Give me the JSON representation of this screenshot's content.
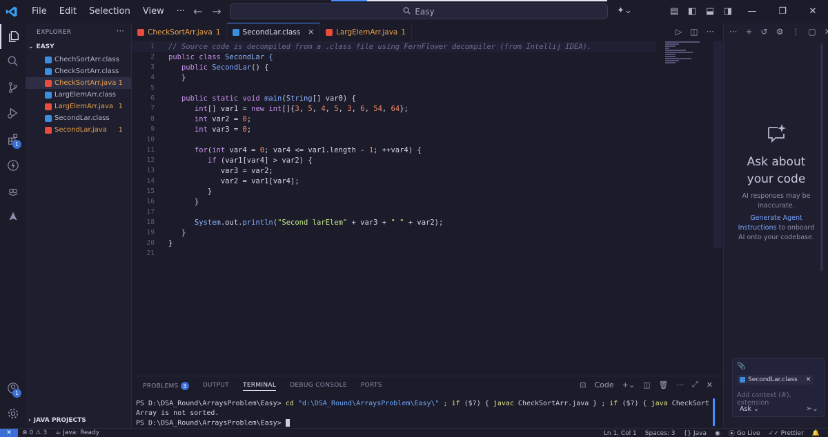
{
  "menu": {
    "file": "File",
    "edit": "Edit",
    "selection": "Selection",
    "view": "View",
    "more": "···"
  },
  "search": {
    "text": "Easy"
  },
  "sidebar": {
    "title": "EXPLORER",
    "more": "···",
    "folder": "EASY",
    "files": [
      {
        "name": "ChechSortArr.class",
        "color": "#3b8ede",
        "text_color": "#b5b5cc",
        "count": ""
      },
      {
        "name": "CheckSortArr.class",
        "color": "#3b8ede",
        "text_color": "#b5b5cc",
        "count": ""
      },
      {
        "name": "CheckSortArr.java",
        "color": "#e74c3c",
        "text_color": "#e9a34a",
        "count": "1"
      },
      {
        "name": "LargElemArr.class",
        "color": "#3b8ede",
        "text_color": "#b5b5cc",
        "count": ""
      },
      {
        "name": "LargElemArr.java",
        "color": "#e74c3c",
        "text_color": "#e9a34a",
        "count": "1"
      },
      {
        "name": "SecondLar.class",
        "color": "#3b8ede",
        "text_color": "#b5b5cc",
        "count": ""
      },
      {
        "name": "SecondLar.java",
        "color": "#e74c3c",
        "text_color": "#e9a34a",
        "count": "1"
      }
    ],
    "java_projects": "JAVA PROJECTS"
  },
  "activity": {
    "ext_badge": "1",
    "account_badge": "1"
  },
  "tabs": [
    {
      "name": "CheckSortArr.java",
      "count": "1",
      "color": "#e74c3c",
      "text_color": "#e9a34a"
    },
    {
      "name": "SecondLar.class",
      "count": "",
      "color": "#3b8ede",
      "text_color": "#e0e0f0",
      "close": "✕"
    },
    {
      "name": "LargElemArr.java",
      "count": "1",
      "color": "#e74c3c",
      "text_color": "#e9a34a"
    }
  ],
  "code": {
    "line_numbers": [
      "1",
      "2",
      "3",
      "4",
      "5",
      "6",
      "7",
      "8",
      "9",
      "10",
      "11",
      "12",
      "13",
      "14",
      "15",
      "16",
      "17",
      "18",
      "19",
      "20",
      "21"
    ],
    "l1": "// Source code is decompiled from a .class file using FernFlower decompiler (from Intellij IDEA).",
    "l2a": "public class",
    "l2b": " SecondLar {",
    "l3a": "   public",
    "l3b": " SecondLar",
    "l3c": "() {",
    "l4": "   }",
    "l6a": "   public static void",
    "l6b": " main",
    "l6c": "(",
    "l6d": "String",
    "l6e": "[] var0) {",
    "l7a": "      int",
    "l7b": "[] var1 = ",
    "l7c": "new int",
    "l7d": "[]{",
    "l7n1": "3",
    "l7n2": "5",
    "l7n3": "4",
    "l7n4": "5",
    "l7n5": "3",
    "l7n6": "6",
    "l7n7": "54",
    "l7n8": "64",
    "l7e": "};",
    "l8a": "      int",
    "l8b": " var2 = ",
    "l8c": "0",
    "l8d": ";",
    "l9a": "      int",
    "l9b": " var3 = ",
    "l9c": "0",
    "l9d": ";",
    "l11a": "      for",
    "l11b": "(",
    "l11c": "int",
    "l11d": " var4 = ",
    "l11e": "0",
    "l11f": "; var4 <= var1.length - ",
    "l11g": "1",
    "l11h": "; ++var4) {",
    "l12a": "         if",
    "l12b": " (var1[var4] > var2) {",
    "l13": "            var3 = var2;",
    "l14": "            var2 = var1[var4];",
    "l15": "         }",
    "l16": "      }",
    "l18a": "      System",
    "l18b": ".out.",
    "l18c": "println",
    "l18d": "(",
    "l18e": "\"Second larElem\"",
    "l18f": " + var3 + ",
    "l18g": "\" \"",
    "l18h": " + var2);",
    "l19": "   }",
    "l20": "}"
  },
  "panel": {
    "tabs": {
      "problems": "PROBLEMS",
      "problems_count": "3",
      "output": "OUTPUT",
      "terminal": "TERMINAL",
      "debug": "DEBUG CONSOLE",
      "ports": "PORTS"
    },
    "code_label": "Code",
    "terminal": {
      "line1_prompt": "PS D:\\DSA_Round\\ArraysProblem\\Easy> ",
      "line1_cd": "cd ",
      "line1_path": "\"d:\\DSA_Round\\ArraysProblem\\Easy\\\"",
      "line1_rest1": " ; ",
      "line1_if1": "if",
      "line1_rest2": " ($?) { ",
      "line1_javac": "javac",
      "line1_rest3": " CheckSortArr.java } ; ",
      "line1_if2": "if",
      "line1_rest4": " ($?) { ",
      "line1_java": "java",
      "line1_rest5": " CheckSortArr }",
      "line2": "Array is not sorted.",
      "line3": "PS D:\\DSA_Round\\ArraysProblem\\Easy> "
    }
  },
  "chat": {
    "title_line1": "Ask about",
    "title_line2": "your code",
    "sub_line1": "AI responses may be",
    "sub_line2": "inaccurate.",
    "gen_link1": "Generate Agent",
    "gen_link2": "Instructions",
    "gen_rest1": " to onboard",
    "gen_rest2": "AI onto your codebase.",
    "context_file": "SecondLar.class",
    "placeholder": "Add context (#), extension",
    "mode": "Ask"
  },
  "status": {
    "errors": "0",
    "warnings": "3",
    "java": "Java: Ready",
    "position": "Ln 1, Col 1",
    "spaces": "Spaces: 3",
    "lang": "Java",
    "golive": "Go Live",
    "prettier": "Prettier"
  }
}
